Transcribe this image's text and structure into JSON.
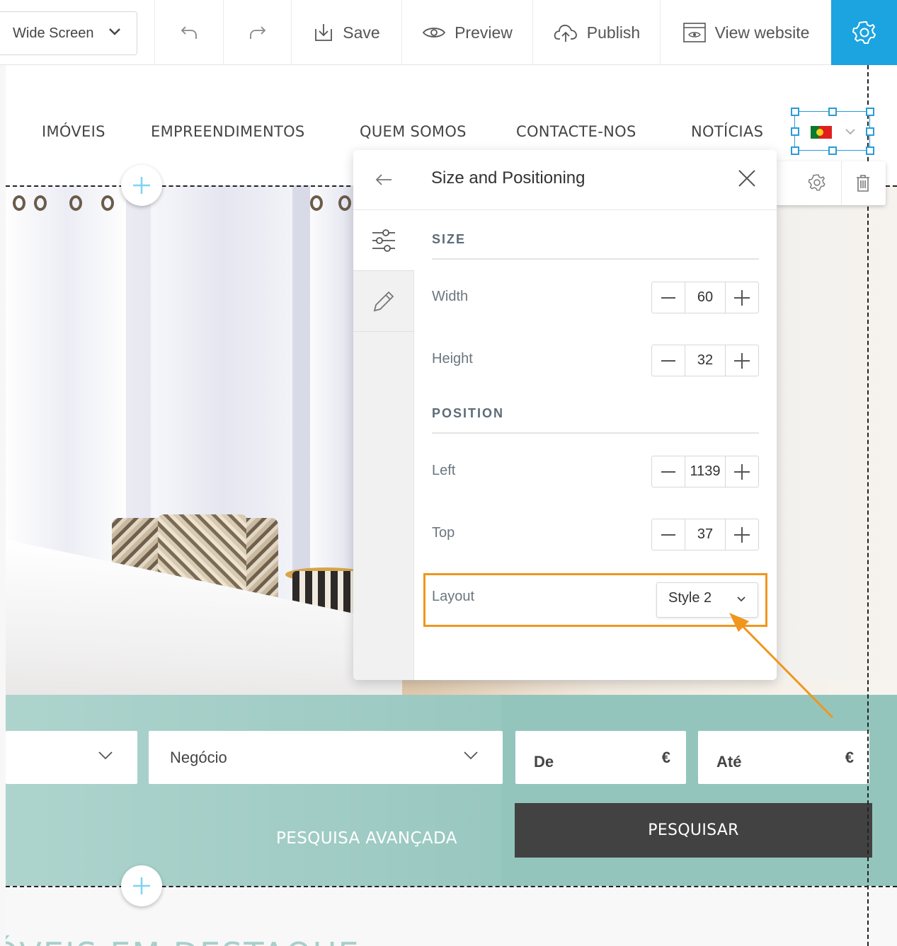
{
  "toolbar": {
    "device_select": "Wide Screen",
    "save": "Save",
    "preview": "Preview",
    "publish": "Publish",
    "view_website": "View website"
  },
  "nav": {
    "items": [
      "IMÓVEIS",
      "EMPREENDIMENTOS",
      "QUEM SOMOS",
      "CONTACTE-NOS",
      "NOTÍCIAS"
    ]
  },
  "panel": {
    "title": "Size and Positioning",
    "size_heading": "SIZE",
    "width_label": "Width",
    "width_value": "60",
    "height_label": "Height",
    "height_value": "32",
    "position_heading": "POSITION",
    "left_label": "Left",
    "left_value": "1139",
    "top_label": "Top",
    "top_value": "37",
    "layout_label": "Layout",
    "layout_value": "Style 2"
  },
  "search": {
    "negocio": "Negócio",
    "de": "De",
    "ate": "Até",
    "currency": "€",
    "advanced": "PESQUISA AVANÇADA",
    "submit": "PESQUISAR"
  },
  "section": {
    "title": "ÓVEIS EM DESTAQUE"
  },
  "colors": {
    "accent_blue": "#1ba4e0",
    "highlight_orange": "#f0961e",
    "search_band": "#93c5bd",
    "search_button": "#424242"
  }
}
